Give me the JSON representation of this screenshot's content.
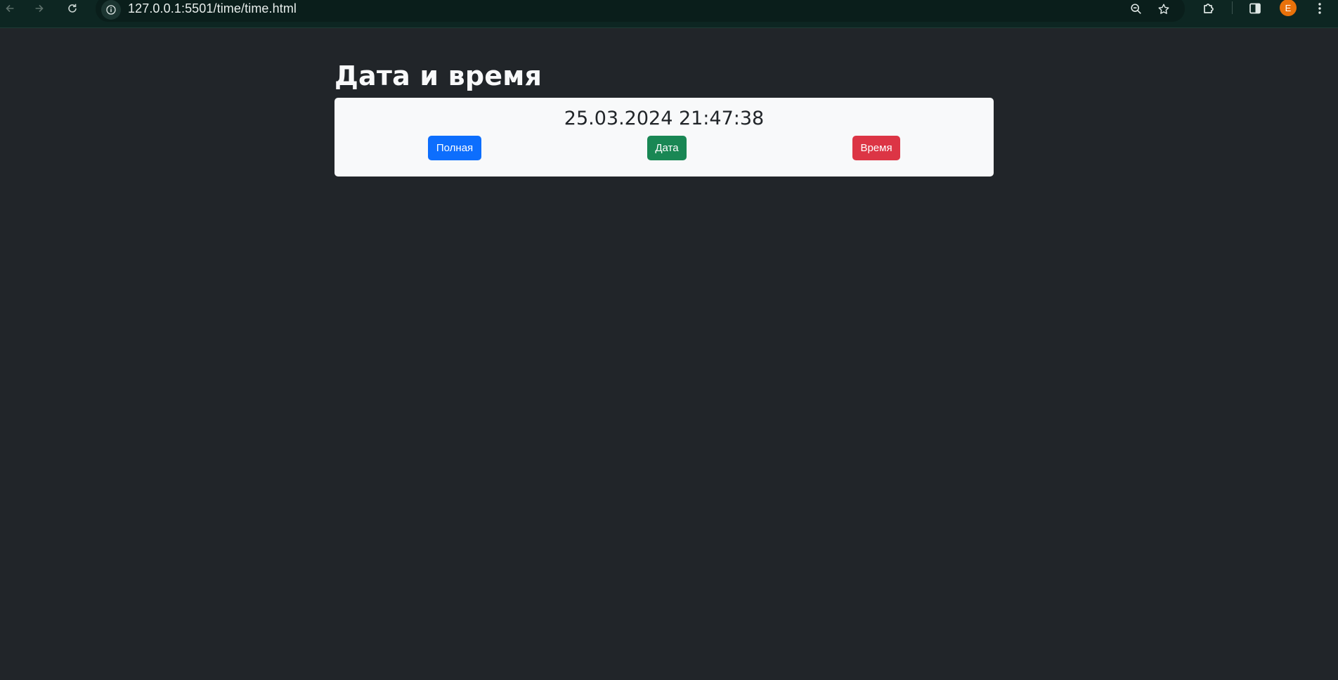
{
  "browser": {
    "url": "127.0.0.1:5501/time/time.html",
    "icons": {
      "back": "arrow-left-icon",
      "forward": "arrow-right-icon",
      "reload": "reload-icon",
      "site_info": "info-icon",
      "zoom": "zoom-out-icon",
      "bookmark": "star-icon",
      "extensions": "puzzle-icon",
      "side_panel": "side-panel-icon",
      "menu": "kebab-menu-icon"
    },
    "profile_initial": "E"
  },
  "page": {
    "title": "Дата и время",
    "datetime": "25.03.2024 21:47:38",
    "buttons": {
      "full": "Полная",
      "date": "Дата",
      "time": "Время"
    }
  },
  "colors": {
    "background": "#212529",
    "card": "#f8f9fa",
    "primary": "#0d6efd",
    "success": "#198754",
    "danger": "#dc3545",
    "avatar": "#e8710a"
  }
}
